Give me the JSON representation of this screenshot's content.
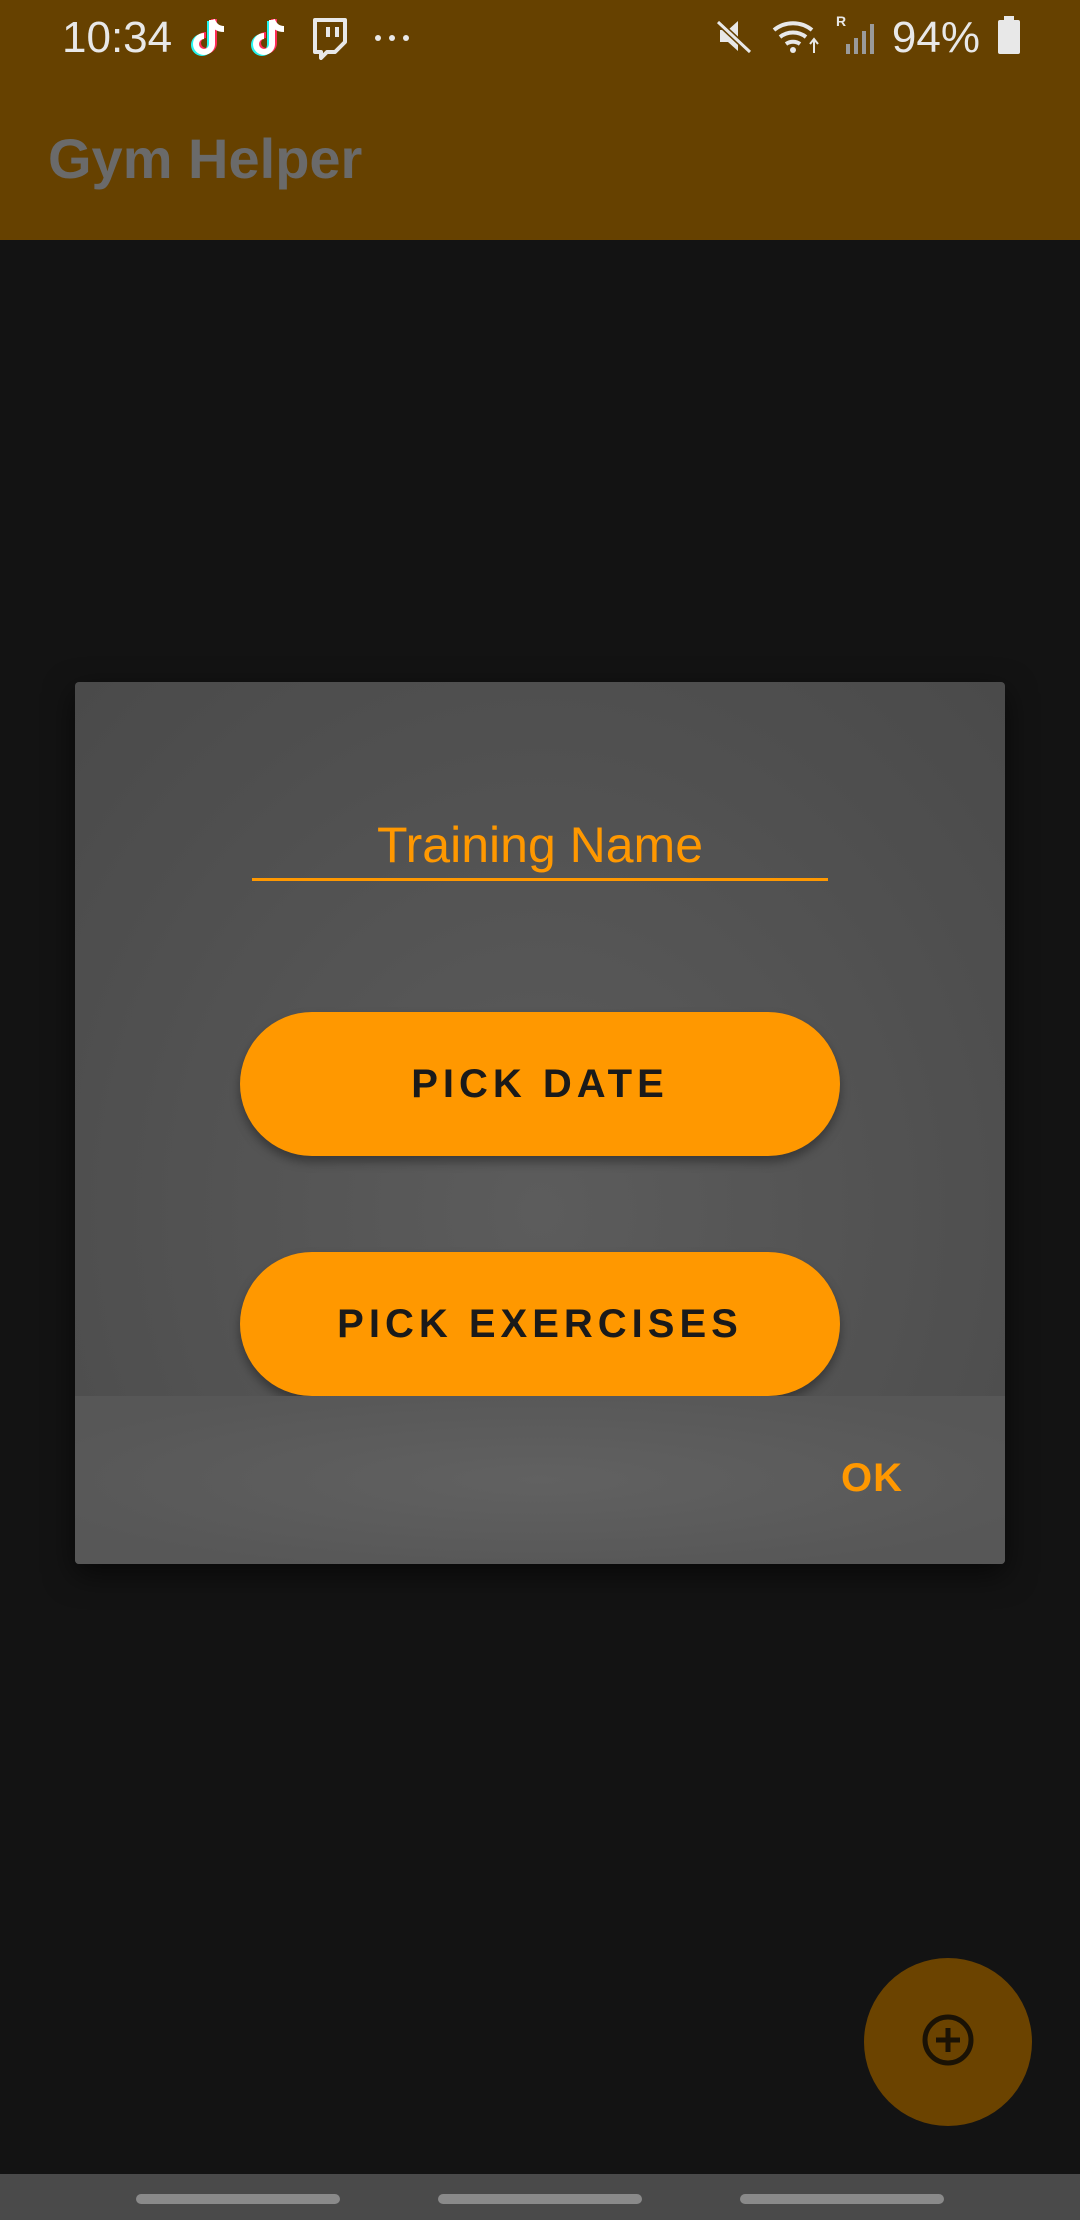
{
  "status_bar": {
    "time": "10:34",
    "notification_icons": [
      "tiktok-icon",
      "tiktok-icon",
      "twitch-icon",
      "more-dots-icon"
    ],
    "system_icons": [
      "mute-icon",
      "wifi-icon",
      "signal-icon",
      "battery-icon"
    ],
    "roaming_indicator": "R",
    "battery_percent": "94%"
  },
  "app_bar": {
    "title": "Gym Helper"
  },
  "dialog": {
    "name_placeholder": "Training Name",
    "pick_date_label": "PICK DATE",
    "pick_exercises_label": "PICK EXERCISES",
    "ok_label": "OK"
  },
  "fab": {
    "icon": "add-circle-icon"
  },
  "colors": {
    "accent": "#ff9800",
    "app_bar": "#664100",
    "background": "#131313",
    "dialog": "#555555"
  }
}
